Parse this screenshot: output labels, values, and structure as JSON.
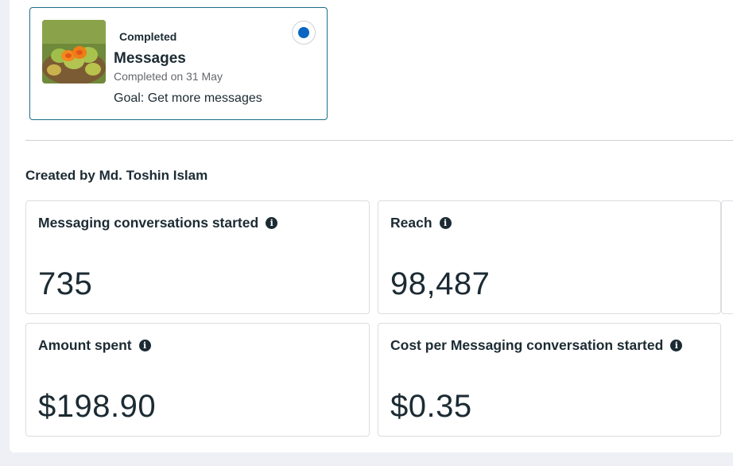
{
  "ad": {
    "status": "Completed",
    "title": "Messages",
    "completed_date": "Completed on 31 May",
    "goal": "Goal: Get more messages",
    "selected": true
  },
  "creator": "Created by Md. Toshin Islam",
  "metrics": [
    {
      "label": "Messaging conversations started",
      "value": "735",
      "icon": "info-icon"
    },
    {
      "label": "Reach",
      "value": "98,487",
      "icon": "info-icon"
    },
    {
      "label": "Amount spent",
      "value": "$198.90",
      "icon": "info-icon"
    },
    {
      "label": "Cost per Messaging conversation started",
      "value": "$0.35",
      "icon": "info-icon"
    }
  ],
  "colors": {
    "card_border": "#1b6e8a",
    "radio_fill": "#0a66c2",
    "text": "#1c2b33",
    "muted": "#65676b"
  }
}
